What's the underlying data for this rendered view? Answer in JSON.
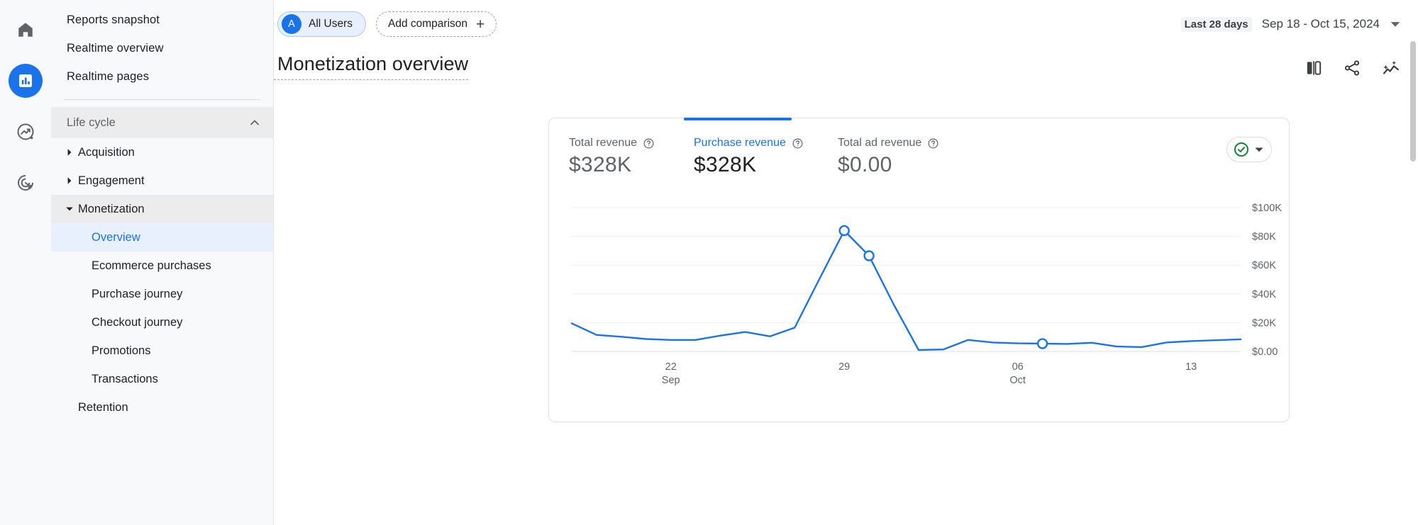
{
  "rail": {
    "items": [
      {
        "name": "home-icon",
        "label": "Home",
        "active": false
      },
      {
        "name": "reports-icon",
        "label": "Reports",
        "active": true
      },
      {
        "name": "explore-icon",
        "label": "Explore",
        "active": false
      },
      {
        "name": "advertising-icon",
        "label": "Advertising",
        "active": false
      }
    ]
  },
  "sidebar": {
    "top_items": [
      {
        "label": "Reports snapshot"
      },
      {
        "label": "Realtime overview"
      },
      {
        "label": "Realtime pages"
      }
    ],
    "group": {
      "label": "Life cycle",
      "collapse_icon": "chevron-up-icon"
    },
    "sections": [
      {
        "label": "Acquisition",
        "expanded": false
      },
      {
        "label": "Engagement",
        "expanded": false
      },
      {
        "label": "Monetization",
        "expanded": true,
        "children": [
          {
            "label": "Overview",
            "active": true
          },
          {
            "label": "Ecommerce purchases",
            "active": false
          },
          {
            "label": "Purchase journey",
            "active": false
          },
          {
            "label": "Checkout journey",
            "active": false
          },
          {
            "label": "Promotions",
            "active": false
          },
          {
            "label": "Transactions",
            "active": false
          }
        ]
      }
    ],
    "retention": {
      "label": "Retention"
    }
  },
  "topbar": {
    "audience_chip": {
      "avatar": "A",
      "label": "All Users"
    },
    "add_comparison": {
      "label": "Add comparison",
      "icon": "plus-icon"
    },
    "date_range": {
      "badge": "Last 28 days",
      "range": "Sep 18 - Oct 15, 2024",
      "caret": "chevron-down-icon"
    }
  },
  "header": {
    "title": "Monetization overview",
    "actions": [
      {
        "name": "compare-view-icon",
        "label": "Compare"
      },
      {
        "name": "share-icon",
        "label": "Share this report"
      },
      {
        "name": "insights-icon",
        "label": "Insights"
      }
    ]
  },
  "card": {
    "metrics": [
      {
        "label": "Total revenue",
        "value": "$328K",
        "selected": false,
        "help_icon": "help-icon"
      },
      {
        "label": "Purchase revenue",
        "value": "$328K",
        "selected": true,
        "help_icon": "help-icon"
      },
      {
        "label": "Total ad revenue",
        "value": "$0.00",
        "selected": false,
        "help_icon": "help-icon"
      }
    ],
    "status_button": {
      "icon": "check-circle-icon",
      "caret": "chevron-down-icon",
      "color": "#188038"
    }
  },
  "chart_data": {
    "type": "line",
    "title": "Purchase revenue",
    "xlabel": "",
    "ylabel": "",
    "grid": true,
    "legend": false,
    "line_color": "#1a73e8",
    "ylim": [
      0,
      100000
    ],
    "yticks": [
      0,
      20000,
      40000,
      60000,
      80000,
      100000
    ],
    "ytick_labels": [
      "$0.00",
      "$20K",
      "$40K",
      "$60K",
      "$80K",
      "$100K"
    ],
    "xticks": [
      4,
      11,
      18,
      25
    ],
    "xtick_labels": [
      [
        "22",
        "Sep"
      ],
      [
        "29",
        ""
      ],
      [
        "06",
        "Oct"
      ],
      [
        "13",
        ""
      ]
    ],
    "x": [
      "Sep 18",
      "Sep 19",
      "Sep 20",
      "Sep 21",
      "Sep 22",
      "Sep 23",
      "Sep 24",
      "Sep 25",
      "Sep 26",
      "Sep 27",
      "Sep 28",
      "Sep 29",
      "Sep 30",
      "Oct 01",
      "Oct 02",
      "Oct 03",
      "Oct 04",
      "Oct 05",
      "Oct 06",
      "Oct 07",
      "Oct 08",
      "Oct 09",
      "Oct 10",
      "Oct 11",
      "Oct 12",
      "Oct 13",
      "Oct 14",
      "Oct 15"
    ],
    "values": [
      19500,
      11500,
      10200,
      8600,
      8000,
      8000,
      11000,
      13500,
      10500,
      16500,
      50500,
      84000,
      66500,
      32500,
      1000,
      1400,
      8000,
      6200,
      5600,
      5400,
      5200,
      6000,
      3400,
      3000,
      6200,
      7200,
      7800,
      8400
    ],
    "markers": [
      {
        "x_index": 11,
        "value": 84000
      },
      {
        "x_index": 12,
        "value": 66500
      },
      {
        "x_index": 19,
        "value": 5400
      }
    ]
  }
}
